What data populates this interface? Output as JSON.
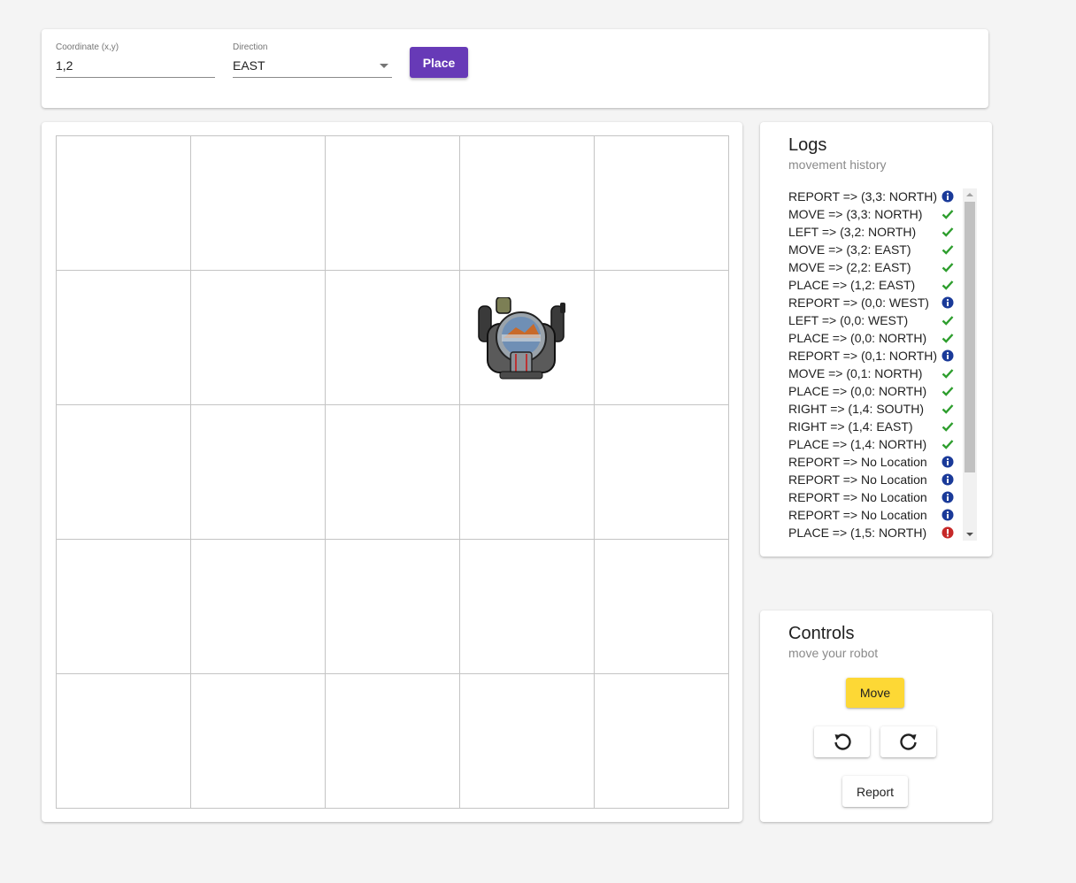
{
  "form": {
    "coordinate_label": "Coordinate (x,y)",
    "coordinate_value": "1,2",
    "direction_label": "Direction",
    "direction_value": "EAST",
    "place_label": "Place"
  },
  "board": {
    "columns": 5,
    "rows": 5,
    "robot": {
      "x": 3,
      "y": 3,
      "icon": "astronaut-robot-icon"
    }
  },
  "logs": {
    "title": "Logs",
    "subtitle": "movement history",
    "entries": [
      {
        "text": "REPORT => (3,3: NORTH)",
        "status": "info"
      },
      {
        "text": "MOVE => (3,3: NORTH)",
        "status": "success"
      },
      {
        "text": "LEFT => (3,2: NORTH)",
        "status": "success"
      },
      {
        "text": "MOVE => (3,2: EAST)",
        "status": "success"
      },
      {
        "text": "MOVE => (2,2: EAST)",
        "status": "success"
      },
      {
        "text": "PLACE => (1,2: EAST)",
        "status": "success"
      },
      {
        "text": "REPORT => (0,0: WEST)",
        "status": "info"
      },
      {
        "text": "LEFT => (0,0: WEST)",
        "status": "success"
      },
      {
        "text": "PLACE => (0,0: NORTH)",
        "status": "success"
      },
      {
        "text": "REPORT => (0,1: NORTH)",
        "status": "info"
      },
      {
        "text": "MOVE => (0,1: NORTH)",
        "status": "success"
      },
      {
        "text": "PLACE => (0,0: NORTH)",
        "status": "success"
      },
      {
        "text": "RIGHT => (1,4: SOUTH)",
        "status": "success"
      },
      {
        "text": "RIGHT => (1,4: EAST)",
        "status": "success"
      },
      {
        "text": "PLACE => (1,4: NORTH)",
        "status": "success"
      },
      {
        "text": "REPORT => No Location",
        "status": "info"
      },
      {
        "text": "REPORT => No Location",
        "status": "info"
      },
      {
        "text": "REPORT => No Location",
        "status": "info"
      },
      {
        "text": "REPORT => No Location",
        "status": "info"
      },
      {
        "text": "PLACE => (1,5: NORTH)",
        "status": "error"
      }
    ]
  },
  "controls": {
    "title": "Controls",
    "subtitle": "move your robot",
    "move_label": "Move",
    "rotate_left_icon": "rotate-left-icon",
    "rotate_right_icon": "rotate-right-icon",
    "report_label": "Report"
  },
  "colors": {
    "primary": "#673ab7",
    "accent": "#fdd835",
    "success": "#2e9e2e",
    "info": "#1a3a99",
    "error": "#c62828"
  }
}
